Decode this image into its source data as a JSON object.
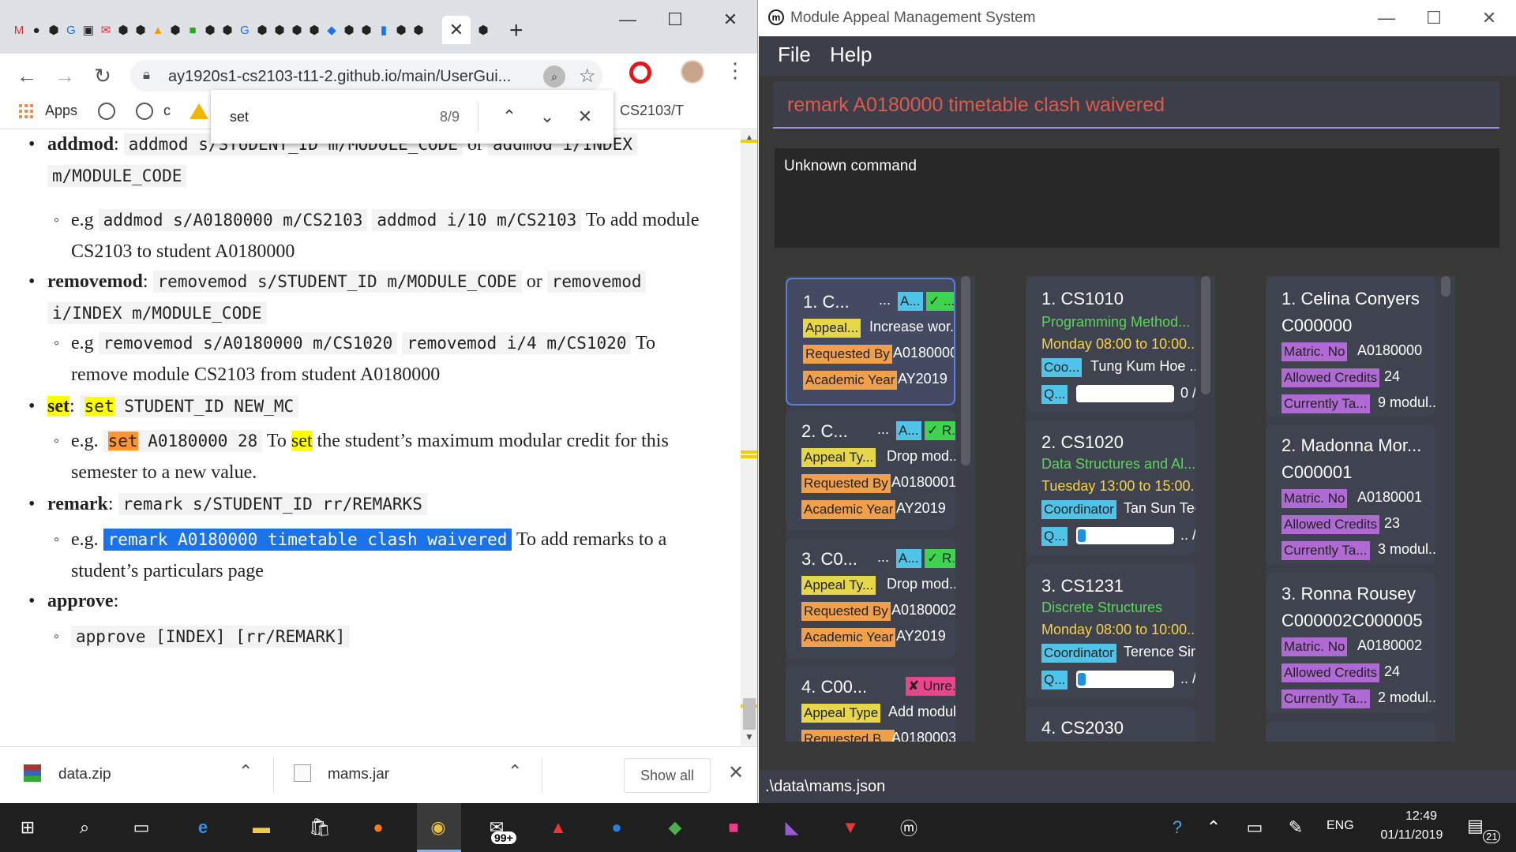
{
  "chrome": {
    "url": "ay1920s1-cs2103-t11-2.github.io/main/UserGui...",
    "bookmarks": {
      "apps": "Apps",
      "c": "c",
      "cs2103": "CS2103/T"
    },
    "find": {
      "query": "set",
      "count": "8/9"
    },
    "downloads": {
      "item1": "data.zip",
      "item2": "mams.jar",
      "show_all": "Show all"
    }
  },
  "doc": {
    "addmod_label": "addmod",
    "addmod_sep": ":",
    "addmod_code1": "addmod s/STUDENT_ID m/MODULE_CODE",
    "addmod_or": "or",
    "addmod_code2": "addmod i/INDEX",
    "addmod_code3": "m/MODULE_CODE",
    "addmod_eg": "e.g",
    "addmod_ex1": "addmod s/A0180000 m/CS2103",
    "addmod_ex2": "addmod i/10 m/CS2103",
    "addmod_desc": "To add module",
    "addmod_desc2": "CS2103 to student A0180000",
    "removemod_label": "removemod",
    "removemod_code1": "removemod s/STUDENT_ID m/MODULE_CODE",
    "removemod_or": "or",
    "removemod_code2": "removemod",
    "removemod_code3": "i/INDEX m/MODULE_CODE",
    "removemod_eg": "e.g",
    "removemod_ex1": "removemod s/A0180000 m/CS1020",
    "removemod_ex2": "removemod i/4 m/CS1020",
    "removemod_desc": "To",
    "removemod_desc2": "remove module CS2103 from student A0180000",
    "set_label": "set",
    "set_code_kw": "set",
    "set_code_rest": " STUDENT_ID NEW_MC",
    "set_eg": "e.g.",
    "set_ex_kw": "set",
    "set_ex_rest": " A0180000 28",
    "set_desc_to": "To",
    "set_desc_kw": "set",
    "set_desc_rest": "the student’s maximum modular credit for this",
    "set_desc2": "semester to a new value.",
    "remark_label": "remark",
    "remark_code": "remark s/STUDENT_ID rr/REMARKS",
    "remark_eg": "e.g.",
    "remark_ex": "remark A0180000 timetable clash waivered",
    "remark_desc": "To add remarks to a",
    "remark_desc2": "student’s particulars page",
    "approve_label": "approve",
    "approve_sep": ":",
    "approve_code": "approve [INDEX] [rr/REMARK]"
  },
  "mams": {
    "title": "Module Appeal Management System",
    "menu": {
      "file": "File",
      "help": "Help"
    },
    "command": "remark A0180000 timetable clash waivered",
    "result": "Unknown command",
    "status": ".\\data\\mams.json",
    "appeals": [
      {
        "title": "1.  C...",
        "dots": "...",
        "tag_a": "A...",
        "tag_status": "✓ ...",
        "tag_type": "Appeal...",
        "type_val": "Increase wor...",
        "tag_req": "Requested By",
        "req_val": "A0180000",
        "tag_year": "Academic Year",
        "year_val": "AY2019"
      },
      {
        "title": "2.  C...",
        "dots": "...",
        "tag_a": "A...",
        "tag_status": "✓ R...",
        "tag_type": "Appeal Ty...",
        "type_val": "Drop mod...",
        "tag_req": "Requested By",
        "req_val": "A0180001",
        "tag_year": "Academic Year",
        "year_val": "AY2019"
      },
      {
        "title": "3.  C0...",
        "dots": "...",
        "tag_a": "A...",
        "tag_status": "✓ R...",
        "tag_type": "Appeal Ty...",
        "type_val": "Drop mod...",
        "tag_req": "Requested By",
        "req_val": "A0180002",
        "tag_year": "Academic Year",
        "year_val": "AY2019"
      },
      {
        "title": "4.  C00...",
        "tag_status": "✘ Unre...",
        "tag_type": "Appeal Type",
        "type_val": "Add module",
        "tag_req": "Requested B...",
        "req_val": "A0180003"
      }
    ],
    "modules": [
      {
        "title": "1.  CS1010",
        "name": "Programming Method...",
        "time": "Monday 08:00 to 10:00...",
        "tag_coord": "Coo...",
        "coord_val": "Tung Kum Hoe ...",
        "tag_q": "Q...",
        "quota": "0 / ...",
        "fill": 0
      },
      {
        "title": "2.  CS1020",
        "name": "Data Structures and Al...",
        "time": "Tuesday 13:00 to 15:00...",
        "tag_coord": "Coordinator",
        "coord_val": "Tan Sun Teck",
        "tag_q": "Q...",
        "quota": ".. / ...",
        "fill": 0.08
      },
      {
        "title": "3.  CS1231",
        "name": "Discrete Structures",
        "time": "Monday 08:00 to 10:00...",
        "tag_coord": "Coordinator",
        "coord_val": "Terence Sim",
        "tag_q": "Q...",
        "quota": ".. / ...",
        "fill": 0.08
      },
      {
        "title": "4.  CS2030"
      }
    ],
    "students": [
      {
        "title": "1.  Celina Conyers",
        "id": "C000000",
        "tag_matric": "Matric. No",
        "matric_val": "A0180000",
        "tag_credits": "Allowed Credits",
        "credits_val": "24",
        "tag_current": "Currently Ta...",
        "current_val": "9  modul..."
      },
      {
        "title": "2.  Madonna Mor...",
        "id": "C000001",
        "tag_matric": "Matric. No",
        "matric_val": "A0180001",
        "tag_credits": "Allowed Credits",
        "credits_val": "23",
        "tag_current": "Currently Ta...",
        "current_val": "3  modul..."
      },
      {
        "title": "3.  Ronna Rousey",
        "id": "C000002C000005",
        "tag_matric": "Matric. No",
        "matric_val": "A0180002",
        "tag_credits": "Allowed Credits",
        "credits_val": "24",
        "tag_current": "Currently Ta...",
        "current_val": "2  modul..."
      }
    ]
  },
  "taskbar": {
    "badge": "99+",
    "lang": "ENG",
    "time": "12:49",
    "date": "01/11/2019",
    "notifications": "21"
  },
  "colors": {
    "tag_cyan": "#4fc3e8",
    "tag_green": "#3fd34f",
    "tag_yellow": "#e6d64a",
    "tag_orange": "#f0a04b",
    "tag_purple": "#b06ad4",
    "tag_pink": "#e8468a"
  }
}
